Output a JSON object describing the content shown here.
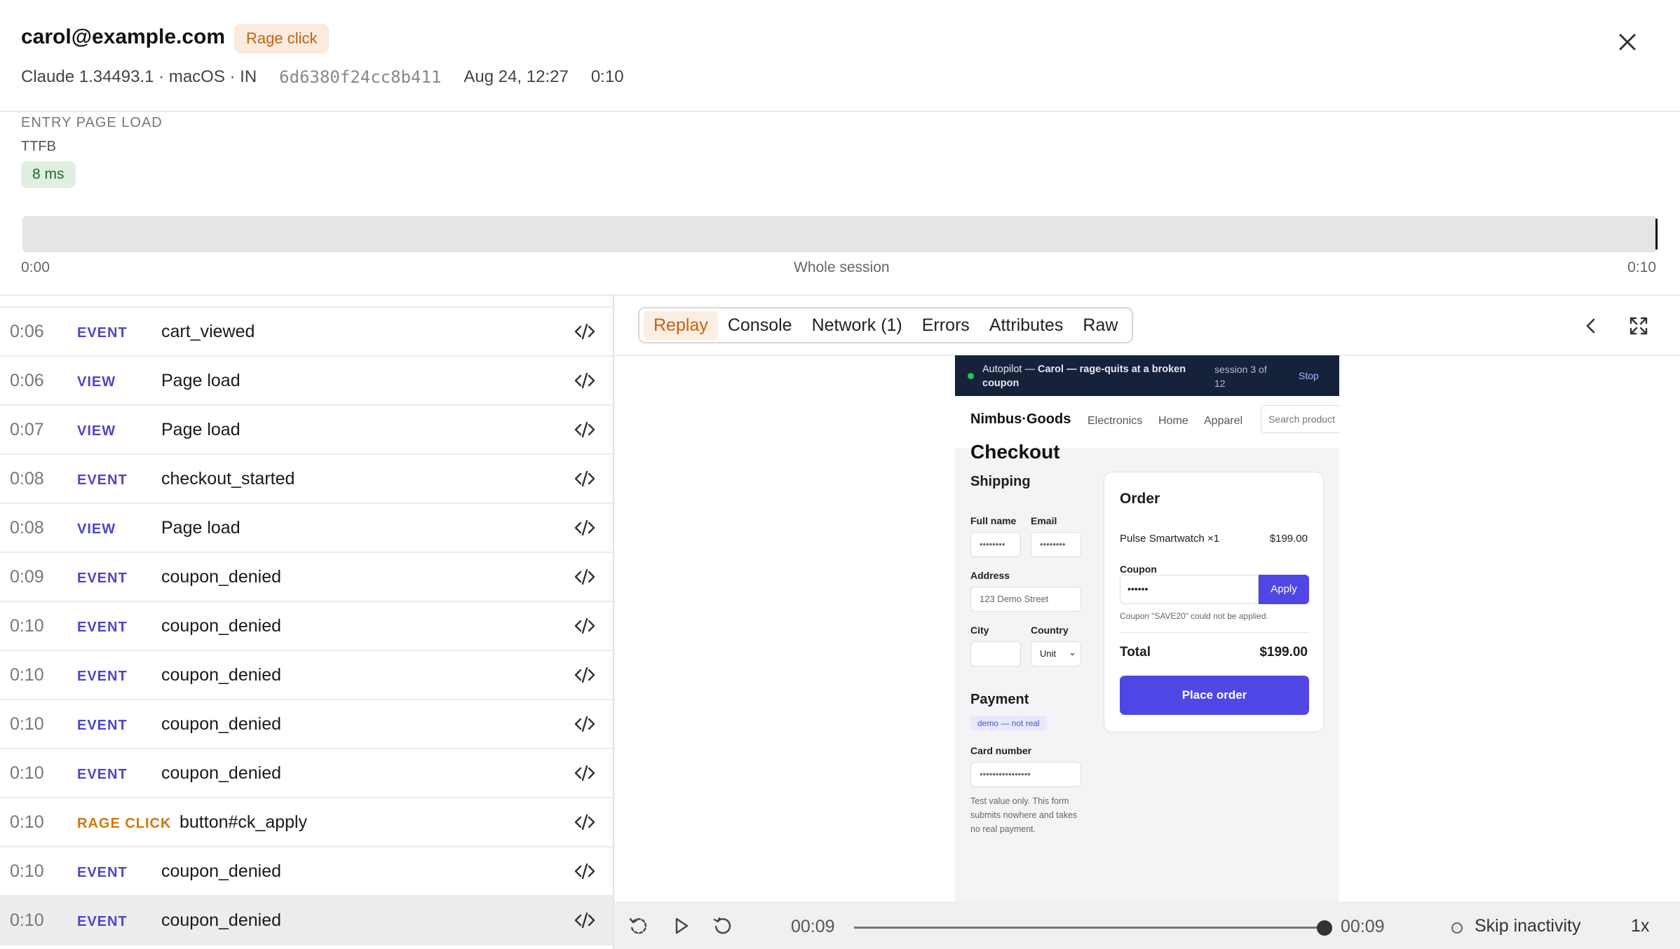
{
  "header": {
    "title": "carol@example.com",
    "badge": "Rage click",
    "meta": {
      "client": "Claude 1.34493.1 · macOS · IN",
      "session_id": "6d6380f24cc8b411",
      "date": "Aug 24, 12:27",
      "duration": "0:10"
    }
  },
  "entry": {
    "section_label": "ENTRY PAGE LOAD",
    "ttfb_label": "TTFB",
    "ttfb_value": "8 ms"
  },
  "timeline": {
    "start": "0:00",
    "label": "Whole session",
    "end": "0:10"
  },
  "events": [
    {
      "time": "0:06",
      "type": "EVENT",
      "name": "cart_viewed"
    },
    {
      "time": "0:06",
      "type": "VIEW",
      "name": "Page load"
    },
    {
      "time": "0:07",
      "type": "VIEW",
      "name": "Page load"
    },
    {
      "time": "0:08",
      "type": "EVENT",
      "name": "checkout_started"
    },
    {
      "time": "0:08",
      "type": "VIEW",
      "name": "Page load"
    },
    {
      "time": "0:09",
      "type": "EVENT",
      "name": "coupon_denied"
    },
    {
      "time": "0:10",
      "type": "EVENT",
      "name": "coupon_denied"
    },
    {
      "time": "0:10",
      "type": "EVENT",
      "name": "coupon_denied"
    },
    {
      "time": "0:10",
      "type": "EVENT",
      "name": "coupon_denied"
    },
    {
      "time": "0:10",
      "type": "EVENT",
      "name": "coupon_denied"
    },
    {
      "time": "0:10",
      "type": "RAGE CLICK",
      "name": "button#ck_apply"
    },
    {
      "time": "0:10",
      "type": "EVENT",
      "name": "coupon_denied"
    },
    {
      "time": "0:10",
      "type": "EVENT",
      "name": "coupon_denied"
    }
  ],
  "tabs": [
    "Replay",
    "Console",
    "Network (1)",
    "Errors",
    "Attributes",
    "Raw"
  ],
  "replay": {
    "autopilot_prefix": "Autopilot — ",
    "autopilot_bold": "Carol — rage-quits at a broken coupon",
    "session": "session 3 of 12",
    "stop": "Stop",
    "brand": "Nimbus·Goods",
    "nav": [
      "Electronics",
      "Home",
      "Apparel"
    ],
    "search_placeholder": "Search product",
    "checkout_title": "Checkout",
    "shipping_title": "Shipping",
    "full_name_label": "Full name",
    "full_name_value": "••••••••",
    "email_label": "Email",
    "email_value": "••••••••",
    "address_label": "Address",
    "address_placeholder": "123 Demo Street",
    "city_label": "City",
    "country_label": "Country",
    "country_value": "Unit",
    "payment_title": "Payment",
    "demo_tag": "demo — not real",
    "card_label": "Card number",
    "card_value": "••••••••••••••••",
    "note": "Test value only. This form submits nowhere and takes no real payment.",
    "order_title": "Order",
    "item": "Pulse Smartwatch ×1",
    "item_price": "$199.00",
    "coupon_label": "Coupon",
    "coupon_value": "••••••",
    "apply": "Apply",
    "coupon_error": "Coupon “SAVE20” could not be applied.",
    "total_label": "Total",
    "total_value": "$199.00",
    "place_order": "Place order"
  },
  "player": {
    "current": "00:09",
    "end": "00:09",
    "progress": 1.0,
    "skip_label": "Skip inactivity",
    "speed": "1x"
  },
  "colors": {
    "accent": "#4f46e5",
    "rage": "#d0780f",
    "event_type": "#4f46c8"
  }
}
